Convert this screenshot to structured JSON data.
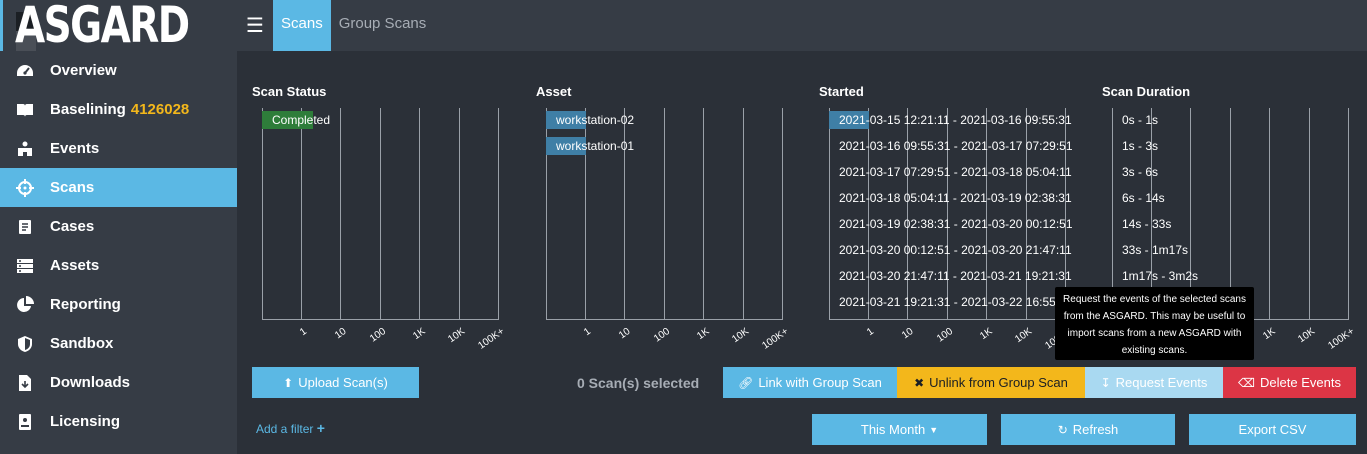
{
  "app": {
    "logo_text": "ASGARD"
  },
  "topbar": {
    "tabs": [
      {
        "label": "Scans"
      },
      {
        "label": "Group Scans"
      }
    ]
  },
  "sidebar": {
    "items": [
      {
        "label": "Overview",
        "icon": "dashboard-icon"
      },
      {
        "label": "Baselining",
        "badge": "4126028",
        "icon": "book-icon"
      },
      {
        "label": "Events",
        "icon": "events-icon"
      },
      {
        "label": "Scans",
        "icon": "crosshair-icon",
        "active": true
      },
      {
        "label": "Cases",
        "icon": "cases-icon"
      },
      {
        "label": "Assets",
        "icon": "server-icon"
      },
      {
        "label": "Reporting",
        "icon": "pie-chart-icon"
      },
      {
        "label": "Sandbox",
        "icon": "shield-icon"
      },
      {
        "label": "Downloads",
        "icon": "download-file-icon"
      },
      {
        "label": "Licensing",
        "icon": "license-icon"
      }
    ]
  },
  "facets": {
    "scan_status": {
      "title": "Scan Status",
      "rows": [
        {
          "label": "Completed",
          "count": 2
        }
      ]
    },
    "asset": {
      "title": "Asset",
      "rows": [
        {
          "label": "workstation-02",
          "count": 1
        },
        {
          "label": "workstation-01",
          "count": 1
        }
      ]
    },
    "started": {
      "title": "Started",
      "rows": [
        {
          "label": "2021-03-15 12:21:11 - 2021-03-16 09:55:31",
          "count": 1
        },
        {
          "label": "2021-03-16 09:55:31 - 2021-03-17 07:29:51",
          "count": 0
        },
        {
          "label": "2021-03-17 07:29:51 - 2021-03-18 05:04:11",
          "count": 0
        },
        {
          "label": "2021-03-18 05:04:11 - 2021-03-19 02:38:31",
          "count": 0
        },
        {
          "label": "2021-03-19 02:38:31 - 2021-03-20 00:12:51",
          "count": 0
        },
        {
          "label": "2021-03-20 00:12:51 - 2021-03-20 21:47:11",
          "count": 0
        },
        {
          "label": "2021-03-20 21:47:11 - 2021-03-21 19:21:31",
          "count": 0
        },
        {
          "label": "2021-03-21 19:21:31 - 2021-03-22 16:55",
          "count": 0
        }
      ]
    },
    "scan_duration": {
      "title": "Scan Duration",
      "rows": [
        {
          "label": "0s - 1s",
          "count": 0
        },
        {
          "label": "1s - 3s",
          "count": 0
        },
        {
          "label": "3s - 6s",
          "count": 0
        },
        {
          "label": "6s - 14s",
          "count": 0
        },
        {
          "label": "14s - 33s",
          "count": 0
        },
        {
          "label": "33s - 1m17s",
          "count": 0
        },
        {
          "label": "1m17s - 3m2s",
          "count": 0
        }
      ]
    },
    "axis_ticks": [
      "1",
      "10",
      "100",
      "1K",
      "10K",
      "100K+"
    ]
  },
  "colors": {
    "accent": "#5bb8e4",
    "completed_bar": "#2e7d3a",
    "asset_bar": "#3f7fa6",
    "started_bar": "#3f7fa6",
    "warning": "#f3b71b",
    "danger": "#dc3545",
    "light_blue": "#a9d9f1"
  },
  "actions": {
    "upload": "Upload Scan(s)",
    "selected": "0 Scan(s) selected",
    "link_group": "Link with Group Scan",
    "unlink_group": "Unlink from Group Scan",
    "request_events": "Request Events",
    "delete_events": "Delete Events",
    "add_filter": "Add a filter",
    "this_month": "This Month",
    "refresh": "Refresh",
    "export_csv": "Export CSV"
  },
  "tooltip": {
    "lines": [
      "Request the events of the selected scans",
      "from the ASGARD. This may be useful to",
      "import scans from a new ASGARD with",
      "existing scans."
    ]
  }
}
